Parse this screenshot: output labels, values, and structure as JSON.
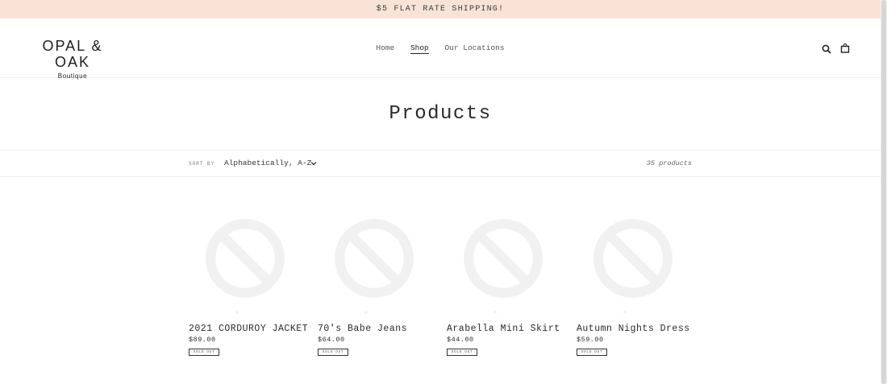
{
  "announcement": "$5 FLAT RATE SHIPPING!",
  "logo": {
    "main": "OPAL & OAK",
    "sub": "Boutique"
  },
  "nav": [
    {
      "label": "Home",
      "active": false
    },
    {
      "label": "Shop",
      "active": true
    },
    {
      "label": "Our Locations",
      "active": false
    }
  ],
  "header_icons": [
    "search-icon",
    "cart-icon"
  ],
  "page_title": "Products",
  "filter": {
    "sort_label": "SORT BY",
    "sort_value": "Alphabetically, A-Z",
    "product_count": "35 products"
  },
  "products": [
    {
      "name": "2021 CORDUROY JACKET",
      "price": "$89.00",
      "badge": "SOLD OUT"
    },
    {
      "name": "70's Babe Jeans",
      "price": "$64.00",
      "badge": "SOLD OUT"
    },
    {
      "name": "Arabella Mini Skirt",
      "price": "$44.00",
      "badge": "SOLD OUT"
    },
    {
      "name": "Autumn Nights Dress",
      "price": "$59.00",
      "badge": "SOLD OUT"
    }
  ],
  "colors": {
    "announcement_bg": "#f9e3d6",
    "text": "#3a3a3a",
    "placeholder": "#f1f1f1"
  }
}
